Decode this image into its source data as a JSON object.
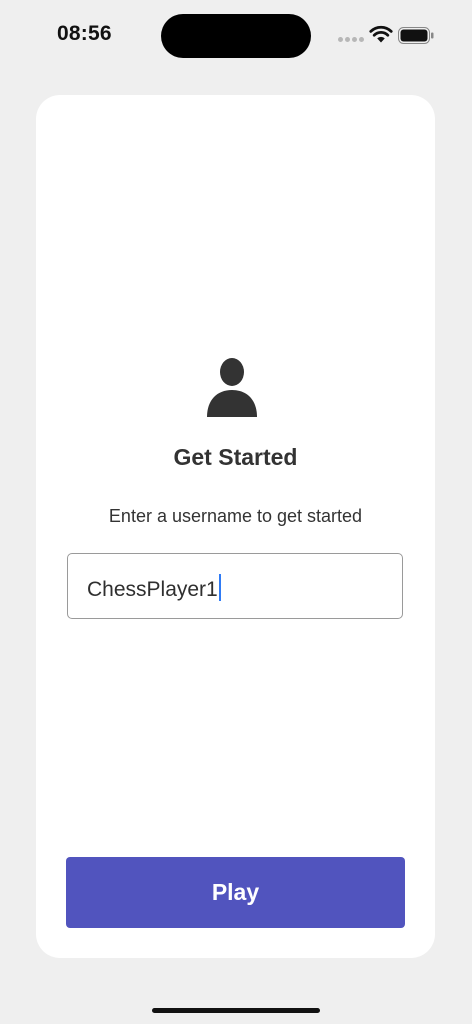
{
  "status_bar": {
    "time": "08:56",
    "icons": [
      "cellular-signal-icon",
      "wifi-icon",
      "battery-icon"
    ]
  },
  "onboarding": {
    "avatar_icon": "person-icon",
    "title": "Get Started",
    "subtitle": "Enter a username to get started",
    "username_value": "ChessPlayer1",
    "play_label": "Play"
  },
  "colors": {
    "background": "#efefef",
    "card": "#ffffff",
    "accent": "#5154be",
    "caret": "#2f7bf5",
    "text": "#333333"
  }
}
